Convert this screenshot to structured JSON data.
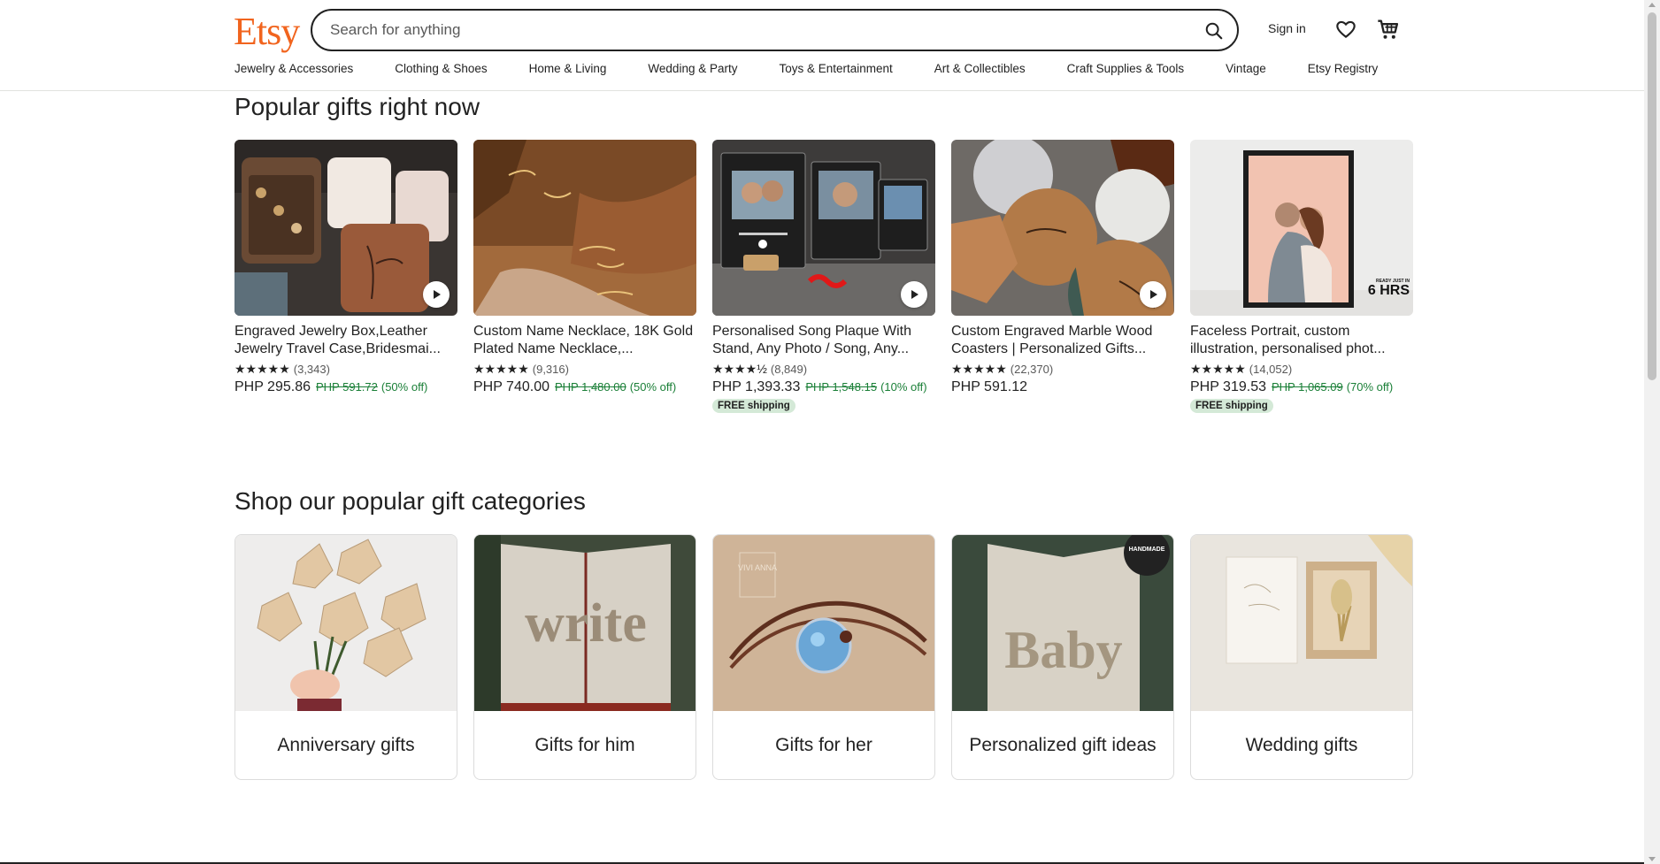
{
  "header": {
    "logo": "Etsy",
    "search_placeholder": "Search for anything",
    "sign_in": "Sign in",
    "icons": {
      "search": "search-icon",
      "favorites": "heart-icon",
      "cart": "cart-icon"
    },
    "brand_color": "#f1641e"
  },
  "nav": [
    "Jewelry & Accessories",
    "Clothing & Shoes",
    "Home & Living",
    "Wedding & Party",
    "Toys & Entertainment",
    "Art & Collectibles",
    "Craft Supplies & Tools",
    "Vintage",
    "Etsy Registry"
  ],
  "popular": {
    "title": "Popular gifts right now",
    "items": [
      {
        "title": "Engraved Jewelry Box,Leather Jewelry Travel Case,Bridesmai...",
        "stars": "★★★★★",
        "reviews": "(3,343)",
        "price": "PHP 295.86",
        "original": "PHP 591.72",
        "discount": "(50% off)",
        "badge": "",
        "video": true
      },
      {
        "title": "Custom Name Necklace, 18K Gold Plated Name Necklace,...",
        "stars": "★★★★★",
        "reviews": "(9,316)",
        "price": "PHP 740.00",
        "original": "PHP 1,480.00",
        "discount": "(50% off)",
        "badge": "",
        "video": false
      },
      {
        "title": "Personalised Song Plaque With Stand, Any Photo / Song, Any...",
        "stars": "★★★★½",
        "reviews": "(8,849)",
        "price": "PHP 1,393.33",
        "original": "PHP 1,548.15",
        "discount": "(10% off)",
        "badge": "FREE shipping",
        "video": true
      },
      {
        "title": "Custom Engraved Marble Wood Coasters | Personalized Gifts...",
        "stars": "★★★★★",
        "reviews": "(22,370)",
        "price": "PHP 591.12",
        "original": "",
        "discount": "",
        "badge": "",
        "video": true
      },
      {
        "title": "Faceless Portrait, custom illustration, personalised phot...",
        "stars": "★★★★★",
        "reviews": "(14,052)",
        "price": "PHP 319.53",
        "original": "PHP 1,065.09",
        "discount": "(70% off)",
        "badge": "FREE shipping",
        "video": false,
        "image_text": "6 HRS",
        "image_subtext": "READY JUST IN"
      }
    ]
  },
  "categories": {
    "title": "Shop our popular gift categories",
    "items": [
      {
        "label": "Anniversary gifts"
      },
      {
        "label": "Gifts for him",
        "image_text": "write"
      },
      {
        "label": "Gifts for her",
        "image_text": "VIVI ANNA"
      },
      {
        "label": "Personalized gift ideas",
        "image_text": "Baby",
        "badge_text": "HANDMADE"
      },
      {
        "label": "Wedding gifts"
      }
    ]
  }
}
